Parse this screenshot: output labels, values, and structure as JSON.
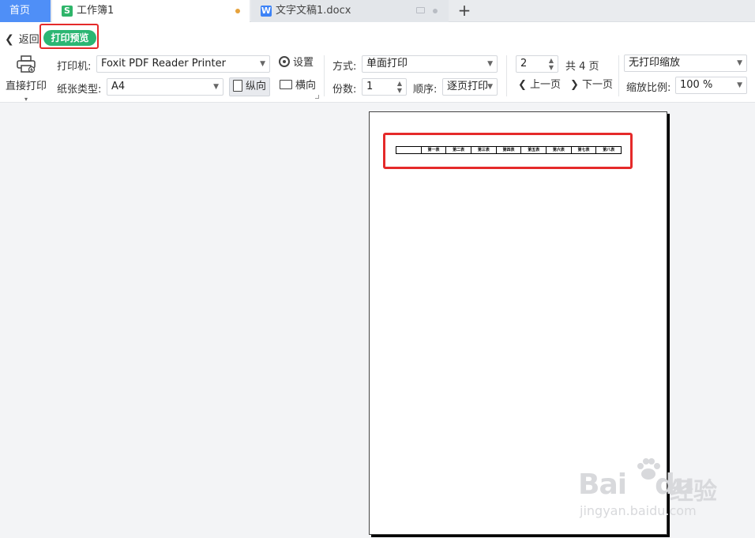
{
  "tabs": {
    "home": "首页",
    "active": {
      "label": "工作簿1",
      "icon": "spreadsheet-icon"
    },
    "doc": {
      "label": "文字文稿1.docx",
      "icon": "writer-doc-icon"
    },
    "new_tab": "+"
  },
  "subbar": {
    "back": "返回",
    "mode": "打印预览"
  },
  "toolbar": {
    "direct_print": "直接打印",
    "printer_label": "打印机:",
    "printer_value": "Foxit PDF Reader Printer",
    "settings": "设置",
    "paper_label": "纸张类型:",
    "paper_value": "A4",
    "portrait": "纵向",
    "landscape": "横向",
    "mode_label": "方式:",
    "mode_value": "单面打印",
    "copies_label": "份数:",
    "copies_value": "1",
    "order_label": "顺序:",
    "order_value": "逐页打印",
    "page_value": "2",
    "page_total": "共 4 页",
    "prev_page": "上一页",
    "next_page": "下一页",
    "scaling_value": "无打印缩放",
    "zoom_label": "缩放比例:",
    "zoom_value": "100 %"
  },
  "preview": {
    "table_headers": [
      "",
      "第一表",
      "第二表",
      "第三表",
      "第四表",
      "第五表",
      "第六表",
      "第七表",
      "第八表"
    ]
  },
  "watermark": {
    "brand": "Bai",
    "brand2": "du",
    "cn": "经验",
    "url": "jingyan.baidu.com"
  },
  "colors": {
    "accent_green": "#2bb673",
    "highlight_red": "#e52a2a",
    "home_tab_blue": "#4f8ff7"
  }
}
